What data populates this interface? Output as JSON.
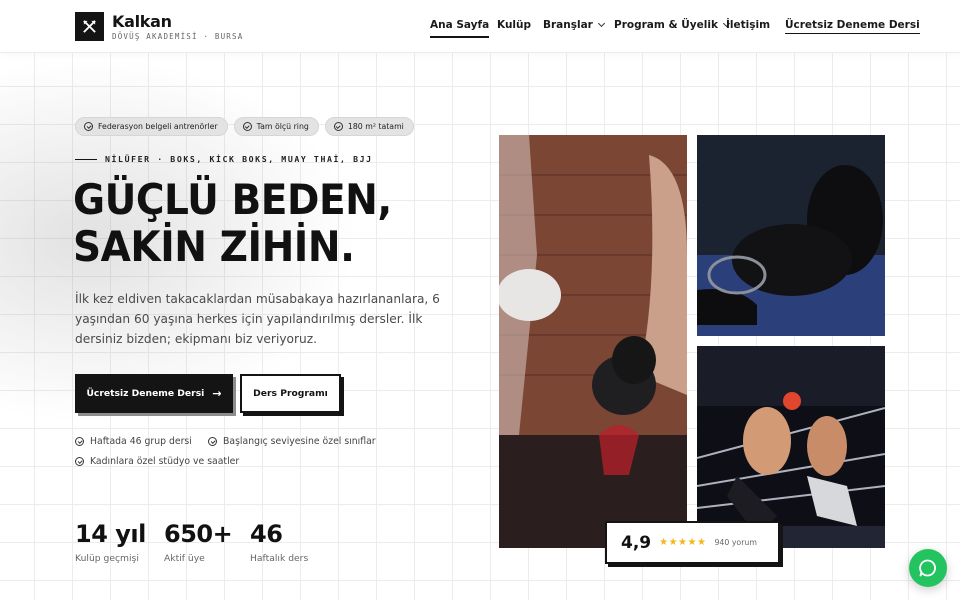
{
  "brand": {
    "name": "Kalkan",
    "subtitle": "DÖVÜŞ AKADEMİSİ · BURSA"
  },
  "nav": {
    "items": [
      {
        "label": "Ana Sayfa",
        "active": true
      },
      {
        "label": "Kulüp"
      },
      {
        "label": "Branşlar",
        "dropdown": true
      },
      {
        "label": "Program & Üyelik",
        "dropdown": true
      },
      {
        "label": "İletişim"
      }
    ],
    "cta": "Ücretsiz Deneme Dersi"
  },
  "hero": {
    "badges": [
      "Federasyon belgeli antrenörler",
      "Tam ölçü ring",
      "180 m² tatami"
    ],
    "eyebrow": "NİLÜFER · BOKS, KİCK BOKS, MUAY THAİ, BJJ",
    "headline": [
      "GÜÇLÜ BEDEN,",
      "SAKİN ZİHİN."
    ],
    "lead": "İlk kez eldiven takacaklardan müsabakaya hazırlananlara, 6 yaşından 60 yaşına herkes için yapılandırılmış dersler. İlk dersiniz bizden; ekipmanı biz veriyoruz.",
    "primary_button": "Ücretsiz Deneme Dersi",
    "secondary_button": "Ders Programı",
    "features": [
      "Haftada 46 grup dersi",
      "Başlangıç seviyesine özel sınıflar",
      "Kadınlara özel stüdyo ve saatler"
    ],
    "stats": [
      {
        "value": "14 yıl",
        "label": "Kulüp geçmişi"
      },
      {
        "value": "650+",
        "label": "Aktif üye"
      },
      {
        "value": "46",
        "label": "Haftalık ders"
      }
    ]
  },
  "rating": {
    "score": "4,9",
    "stars": "★★★★★",
    "count": "940 yorum"
  },
  "colors": {
    "ink": "#141414",
    "star": "#f5b619",
    "whatsapp": "#23c35f"
  }
}
